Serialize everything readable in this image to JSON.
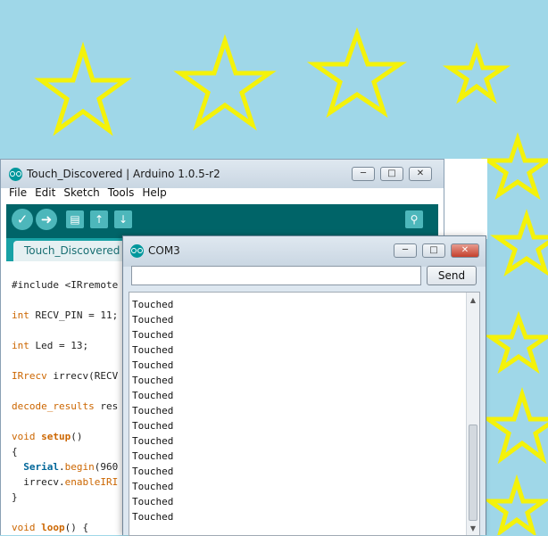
{
  "ide": {
    "title": "Touch_Discovered | Arduino 1.0.5-r2",
    "menu": [
      "File",
      "Edit",
      "Sketch",
      "Tools",
      "Help"
    ],
    "tab": "Touch_Discovered",
    "code": {
      "l1": "#include <IRremote",
      "l2a": "int",
      "l2b": " RECV_PIN = 11;",
      "l3a": "int",
      "l3b": " Led = 13;",
      "l4a": "IRrecv",
      "l4b": " irrecv(RECV",
      "l5a": "decode_results",
      "l5b": " res",
      "l6a": "void",
      "l6b": "setup",
      "l6c": "()",
      "l7": "{",
      "l8a": "Serial",
      "l8b": ".",
      "l8c": "begin",
      "l8d": "(960",
      "l9a": "  irrecv.",
      "l9b": "enableIRI",
      "l10": "}",
      "l11a": "void",
      "l11b": "loop",
      "l11c": "() {"
    },
    "colors": {
      "toolbar": "#006468",
      "tabs": "#17a1a5"
    }
  },
  "serial_monitor": {
    "title": "COM3",
    "input_value": "",
    "send_label": "Send",
    "output_lines": [
      "Touched",
      "Touched",
      "Touched",
      "Touched",
      "Touched",
      "Touched",
      "Touched",
      "Touched",
      "Touched",
      "Touched",
      "Touched",
      "Touched",
      "Touched",
      "Touched",
      "Touched"
    ]
  },
  "background": {
    "color": "#9fd7e8",
    "star_color": "#ffff00"
  }
}
